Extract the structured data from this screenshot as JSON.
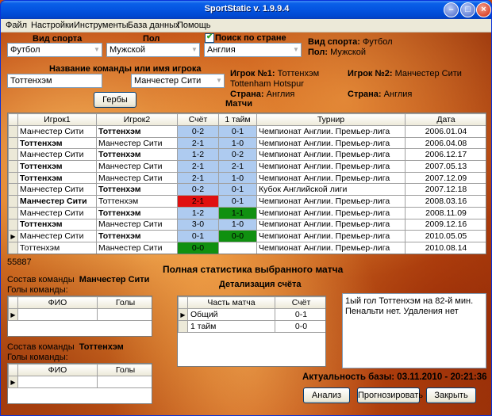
{
  "window": {
    "title": "SportStatic v. 1.9.9.4"
  },
  "menu": [
    "Файл",
    "Настройки",
    "Инструменты",
    "База данных",
    "Помощь"
  ],
  "filters": {
    "sport_label": "Вид спорта",
    "sport_value": "Футбол",
    "gender_label": "Пол",
    "gender_value": "Мужской",
    "country_check_label": "Поиск по стране",
    "country_checked": true,
    "country_value": "Англия",
    "team_label": "Название команды или имя игрока",
    "team1_value": "Тоттенхэм",
    "team2_value": "Манчестер Сити",
    "emblems_button": "Гербы"
  },
  "info": {
    "sport_label": "Вид спорта:",
    "sport_value": "Футбол",
    "gender_label": "Пол:",
    "gender_value": "Мужской",
    "player1_label": "Игрок №1:",
    "player1_value": "Тоттенхэм",
    "player1_full": "Tottenham Hotspur",
    "player1_country_label": "Страна:",
    "player1_country": "Англия",
    "player2_label": "Игрок №2:",
    "player2_value": "Манчестер Сити",
    "player2_country_label": "Страна:",
    "player2_country": "Англия",
    "matches_label": "Матчи"
  },
  "matches": {
    "columns": [
      "Игрок1",
      "Игрок2",
      "Счёт",
      "1 тайм",
      "Турнир",
      "Дата"
    ],
    "rows": [
      {
        "p1": "Манчестер Сити",
        "p2": "Тоттенхэм",
        "score": "0-2",
        "half": "0-1",
        "tournament": "Чемпионат Англии. Премьер-лига",
        "date": "2006.01.04",
        "bold": 2,
        "score_style": "score",
        "half_style": "half",
        "current": false
      },
      {
        "p1": "Тоттенхэм",
        "p2": "Манчестер Сити",
        "score": "2-1",
        "half": "1-0",
        "tournament": "Чемпионат Англии. Премьер-лига",
        "date": "2006.04.08",
        "bold": 1,
        "score_style": "score",
        "half_style": "half",
        "current": false
      },
      {
        "p1": "Манчестер Сити",
        "p2": "Тоттенхэм",
        "score": "1-2",
        "half": "0-2",
        "tournament": "Чемпионат Англии. Премьер-лига",
        "date": "2006.12.17",
        "bold": 2,
        "score_style": "score",
        "half_style": "half",
        "current": false
      },
      {
        "p1": "Тоттенхэм",
        "p2": "Манчестер Сити",
        "score": "2-1",
        "half": "2-1",
        "tournament": "Чемпионат Англии. Премьер-лига",
        "date": "2007.05.13",
        "bold": 1,
        "score_style": "score",
        "half_style": "half",
        "current": false
      },
      {
        "p1": "Тоттенхэм",
        "p2": "Манчестер Сити",
        "score": "2-1",
        "half": "1-0",
        "tournament": "Чемпионат Англии. Премьер-лига",
        "date": "2007.12.09",
        "bold": 1,
        "score_style": "score",
        "half_style": "half",
        "current": false
      },
      {
        "p1": "Манчестер Сити",
        "p2": "Тоттенхэм",
        "score": "0-2",
        "half": "0-1",
        "tournament": "Кубок Английской лиги",
        "date": "2007.12.18",
        "bold": 2,
        "score_style": "score",
        "half_style": "half",
        "current": false
      },
      {
        "p1": "Манчестер Сити",
        "p2": "Тоттенхэм",
        "score": "2-1",
        "half": "0-1",
        "tournament": "Чемпионат Англии. Премьер-лига",
        "date": "2008.03.16",
        "bold": 1,
        "score_style": "red",
        "half_style": "half",
        "current": false
      },
      {
        "p1": "Манчестер Сити",
        "p2": "Тоттенхэм",
        "score": "1-2",
        "half": "1-1",
        "tournament": "Чемпионат Англии. Премьер-лига",
        "date": "2008.11.09",
        "bold": 2,
        "score_style": "score",
        "half_style": "green",
        "current": false
      },
      {
        "p1": "Тоттенхэм",
        "p2": "Манчестер Сити",
        "score": "3-0",
        "half": "1-0",
        "tournament": "Чемпионат Англии. Премьер-лига",
        "date": "2009.12.16",
        "bold": 1,
        "score_style": "score",
        "half_style": "half",
        "current": false
      },
      {
        "p1": "Манчестер Сити",
        "p2": "Тоттенхэм",
        "score": "0-1",
        "half": "0-0",
        "tournament": "Чемпионат Англии. Премьер-лига",
        "date": "2010.05.05",
        "bold": 2,
        "score_style": "score",
        "half_style": "green",
        "current": true
      },
      {
        "p1": "Тоттенхэм",
        "p2": "Манчестер Сити",
        "score": "0-0",
        "half": "",
        "tournament": "Чемпионат Англии. Премьер-лига",
        "date": "2010.08.14",
        "bold": 0,
        "score_style": "green",
        "half_style": "empty",
        "current": false
      }
    ]
  },
  "match_id": "55887",
  "stats": {
    "title": "Полная статистика выбранного матча",
    "team1_label": "Состав команды",
    "team1_name": "Манчестер Сити",
    "team1_goals_label": "Голы команды:",
    "team2_label": "Состав команды",
    "team2_name": "Тоттенхэм",
    "team2_goals_label": "Голы команды:",
    "player_col": "ФИО",
    "goals_col": "Голы",
    "detail_title": "Детализация счёта",
    "detail_cols": [
      "Часть матча",
      "Счёт"
    ],
    "detail_rows": [
      {
        "part": "Общий",
        "score": "0-1"
      },
      {
        "part": "1 тайм",
        "score": "0-0"
      }
    ],
    "note": "1ый гол Тоттенхэм на 82-й мин. Пенальти нет. Удаления нет"
  },
  "footer": {
    "db_actual": "Актуальность базы: 03.11.2010 - 20:21:36",
    "analyze": "Анализ",
    "predict": "Прогнозировать",
    "close": "Закрыть"
  },
  "icons": {
    "row_pointer": "triangle-right",
    "dropdown": "chevron-down",
    "check": "check-mark"
  }
}
